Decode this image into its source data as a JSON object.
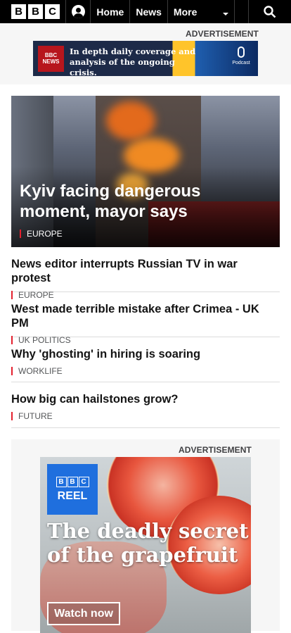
{
  "nav": {
    "logo": [
      "B",
      "B",
      "C"
    ],
    "home": "Home",
    "news": "News",
    "more": "More"
  },
  "ad_top": {
    "label": "ADVERTISEMENT",
    "logo_line1": "BBC",
    "logo_line2": "NEWS",
    "text": "In depth daily coverage and analysis of the ongoing crisis.",
    "podcast": "Podcast"
  },
  "hero": {
    "title": "Kyiv facing dangerous moment, mayor says",
    "tag": "EUROPE"
  },
  "stories": [
    {
      "title": "News editor interrupts Russian TV in war protest",
      "tag": "EUROPE"
    },
    {
      "title": "West made terrible mistake after Crimea - UK PM",
      "tag": "UK POLITICS"
    },
    {
      "title": "Why 'ghosting' in hiring is soaring",
      "tag": "WORKLIFE"
    },
    {
      "title": "How big can hailstones grow?",
      "tag": "FUTURE"
    }
  ],
  "ad_bottom": {
    "label": "ADVERTISEMENT",
    "logo_letters": [
      "B",
      "B",
      "C"
    ],
    "logo_word": "REEL",
    "headline": "The deadly secret of the grapefruit",
    "cta": "Watch now"
  },
  "colors": {
    "nav_bg": "#000000",
    "tag_accent": "#e4202e",
    "reel_blue": "#1f6fde"
  }
}
